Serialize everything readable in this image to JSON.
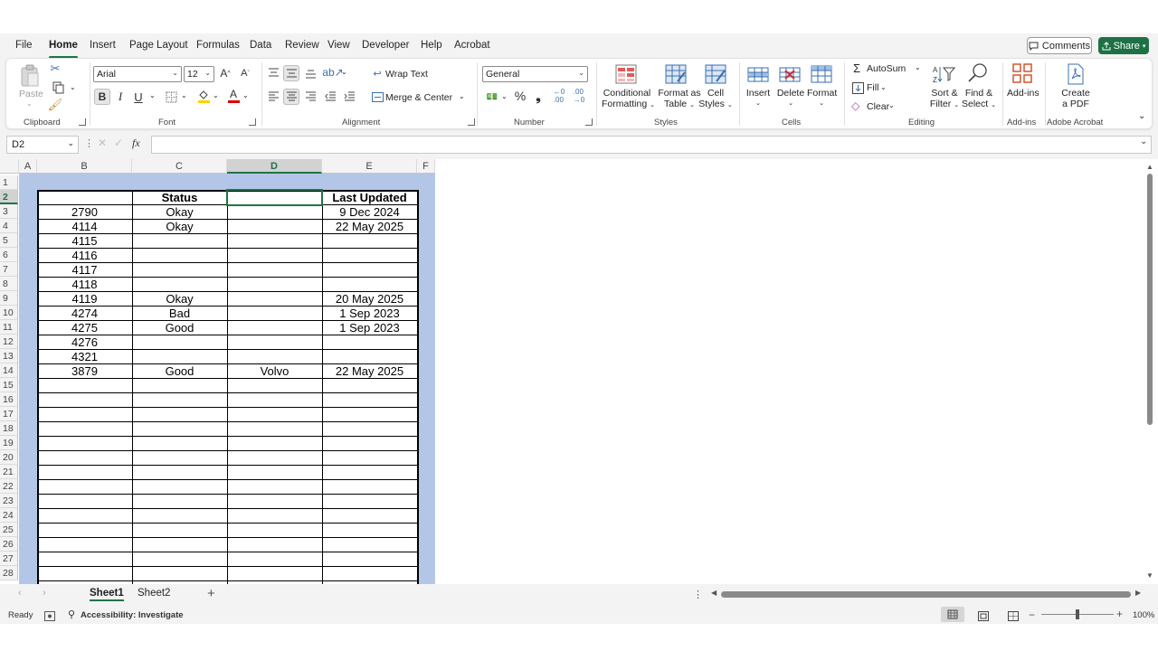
{
  "menu": {
    "tabs": [
      "File",
      "Home",
      "Insert",
      "Page Layout",
      "Formulas",
      "Data",
      "Review",
      "View",
      "Developer",
      "Help",
      "Acrobat"
    ],
    "active": "Home",
    "comments_label": "Comments",
    "share_label": "Share"
  },
  "ribbon": {
    "clipboard": {
      "paste_label": "Paste",
      "group_label": "Clipboard"
    },
    "font": {
      "font_name": "Arial",
      "font_size": "12",
      "bold": "B",
      "italic": "I",
      "underline": "U",
      "group_label": "Font"
    },
    "alignment": {
      "wrap_text": "Wrap Text",
      "merge_center": "Merge & Center",
      "group_label": "Alignment"
    },
    "number": {
      "format": "General",
      "group_label": "Number"
    },
    "styles": {
      "conditional_1": "Conditional",
      "conditional_2": "Formatting",
      "format_table_1": "Format as",
      "format_table_2": "Table",
      "cell_styles_1": "Cell",
      "cell_styles_2": "Styles",
      "group_label": "Styles"
    },
    "cells": {
      "insert": "Insert",
      "delete": "Delete",
      "format": "Format",
      "group_label": "Cells"
    },
    "editing": {
      "autosum": "AutoSum",
      "fill": "Fill",
      "clear": "Clear",
      "sort_1": "Sort &",
      "sort_2": "Filter",
      "find_1": "Find &",
      "find_2": "Select",
      "group_label": "Editing"
    },
    "addins": {
      "label": "Add-ins",
      "group_label": "Add-ins"
    },
    "acrobat": {
      "label_1": "Create",
      "label_2": "a PDF",
      "group_label": "Adobe Acrobat"
    }
  },
  "formula_bar": {
    "name_box": "D2",
    "fx": "fx",
    "value": ""
  },
  "columns": [
    "A",
    "B",
    "C",
    "D",
    "E",
    "F"
  ],
  "rows": [
    "1",
    "2",
    "3",
    "4",
    "5",
    "6",
    "7",
    "8",
    "9",
    "10",
    "11",
    "12",
    "13",
    "14",
    "15",
    "16",
    "17",
    "18",
    "19",
    "20",
    "21",
    "22",
    "23",
    "24",
    "25",
    "26",
    "27",
    "28"
  ],
  "table": {
    "headers": [
      "",
      "Status",
      "",
      "Last Updated"
    ],
    "rows": [
      [
        "2790",
        "Okay",
        "",
        "9 Dec 2024"
      ],
      [
        "4114",
        "Okay",
        "",
        "22 May 2025"
      ],
      [
        "4115",
        "",
        "",
        ""
      ],
      [
        "4116",
        "",
        "",
        ""
      ],
      [
        "4117",
        "",
        "",
        ""
      ],
      [
        "4118",
        "",
        "",
        ""
      ],
      [
        "4119",
        "Okay",
        "",
        "20 May 2025"
      ],
      [
        "4274",
        "Bad",
        "",
        "1 Sep 2023"
      ],
      [
        "4275",
        "Good",
        "",
        "1 Sep 2023"
      ],
      [
        "4276",
        "",
        "",
        ""
      ],
      [
        "4321",
        "",
        "",
        ""
      ],
      [
        "3879",
        "Good",
        "Volvo",
        "22 May 2025"
      ]
    ]
  },
  "sheets": [
    "Sheet1",
    "Sheet2"
  ],
  "active_sheet": "Sheet1",
  "status": {
    "ready": "Ready",
    "accessibility": "Accessibility: Investigate",
    "zoom": "100%"
  },
  "colors": {
    "accent": "#217346",
    "table_fill": "#b4c6e7",
    "share": "#1e7145"
  }
}
